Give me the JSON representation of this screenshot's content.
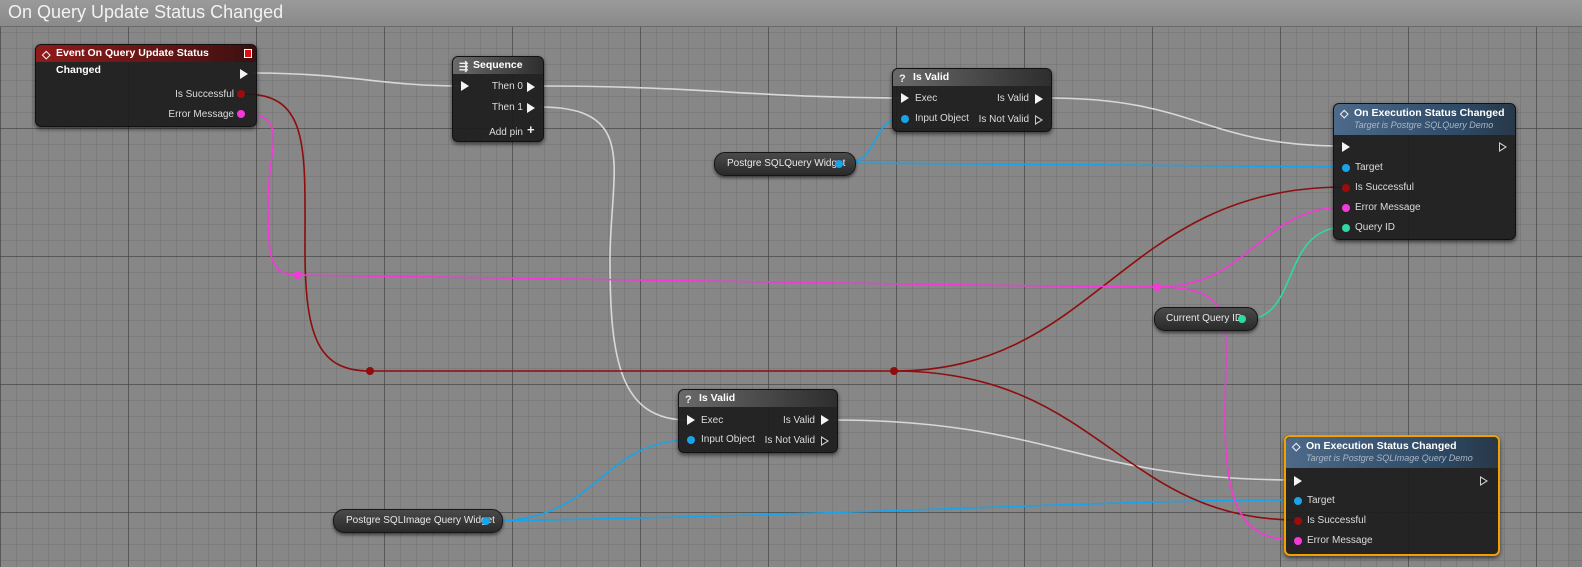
{
  "graph": {
    "title": "On Query Update Status Changed"
  },
  "event_node": {
    "title": "Event On Query Update Status Changed",
    "pins": [
      "Is Successful",
      "Error Message"
    ]
  },
  "sequence_node": {
    "title": "Sequence",
    "pins": [
      "Then 0",
      "Then 1"
    ],
    "add_pin": "Add pin"
  },
  "is_valid_top": {
    "title": "Is Valid",
    "exec": "Exec",
    "input": "Input Object",
    "out_valid": "Is Valid",
    "out_not_valid": "Is Not Valid"
  },
  "is_valid_bottom": {
    "title": "Is Valid",
    "exec": "Exec",
    "input": "Input Object",
    "out_valid": "Is Valid",
    "out_not_valid": "Is Not Valid"
  },
  "exec_status_top": {
    "title": "On Execution Status Changed",
    "subtitle": "Target is Postgre SQLQuery Demo",
    "pins": [
      "Target",
      "Is Successful",
      "Error Message",
      "Query ID"
    ]
  },
  "exec_status_bottom": {
    "title": "On Execution Status Changed",
    "subtitle": "Target is Postgre SQLImage Query Demo",
    "pins": [
      "Target",
      "Is Successful",
      "Error Message"
    ]
  },
  "variables": {
    "query_widget": "Postgre SQLQuery Widget",
    "image_widget": "Postgre SQLImage Query Widget",
    "current_query_id": "Current Query ID"
  },
  "colors": {
    "exec_wire": "#d8d8d8",
    "object_wire": "#1aa3e8",
    "bool_wire": "#8e0d0d",
    "string_wire": "#f33ad8",
    "int_wire": "#2fd9a6",
    "selection": "#f0a000"
  }
}
